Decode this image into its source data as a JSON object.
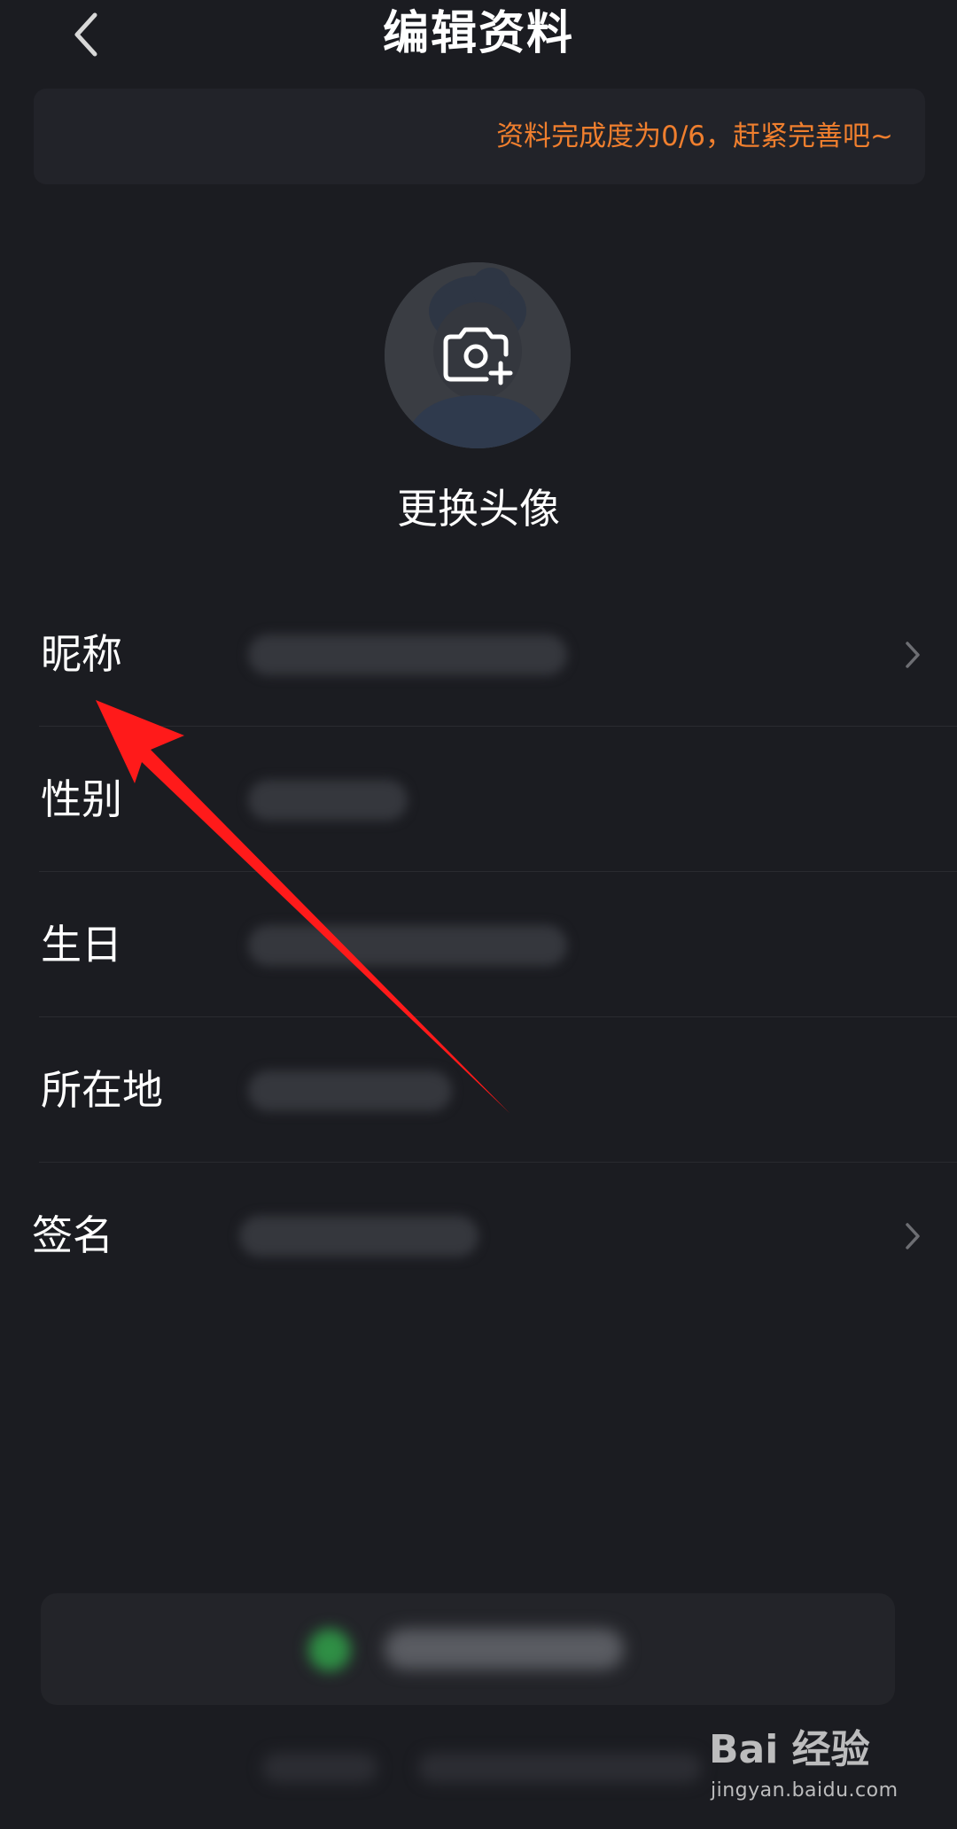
{
  "header": {
    "title": "编辑资料"
  },
  "banner": {
    "text": "资料完成度为0/6，赶紧完善吧~"
  },
  "avatar": {
    "label": "更换头像"
  },
  "form": {
    "rows": [
      {
        "label": "昵称"
      },
      {
        "label": "性别"
      },
      {
        "label": "生日"
      },
      {
        "label": "所在地"
      },
      {
        "label": "签名"
      }
    ]
  },
  "watermark": {
    "brand": "Bai 经验",
    "url": "jingyan.baidu.com"
  },
  "colors": {
    "background": "#1b1c21",
    "accent_orange": "#f07f2e",
    "annotation_red": "#ff1a1a"
  }
}
